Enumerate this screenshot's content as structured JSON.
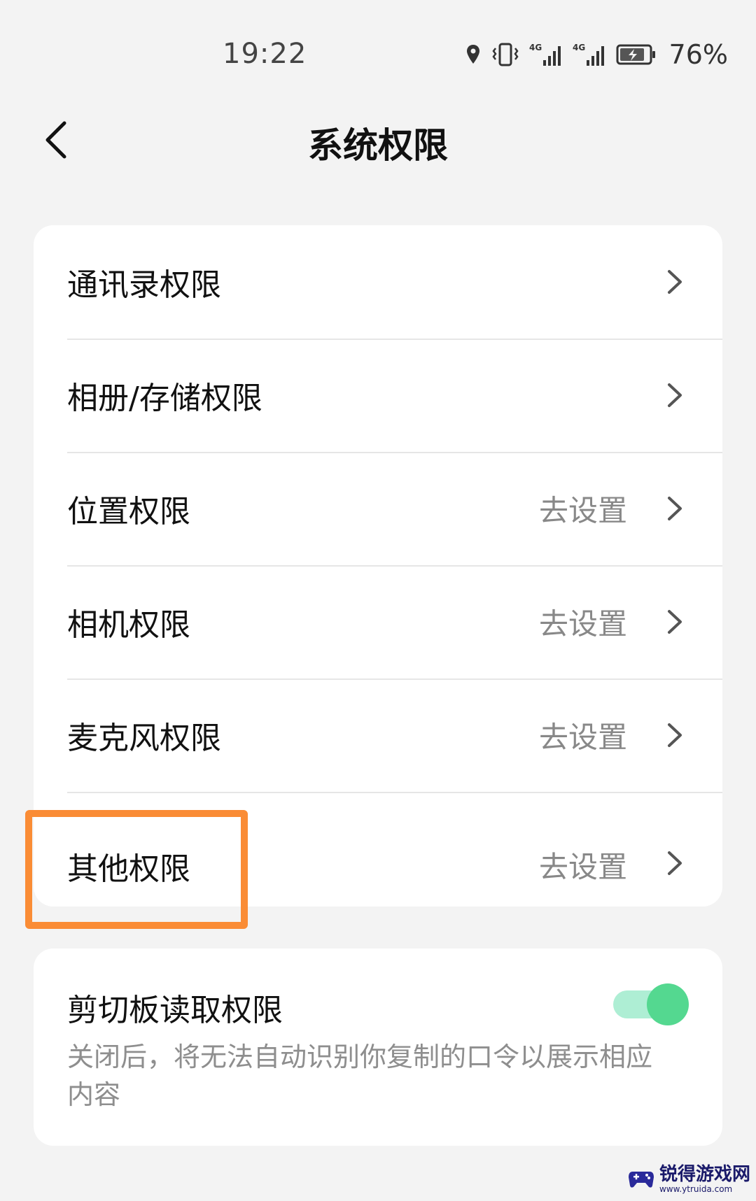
{
  "status_bar": {
    "time": "19:22",
    "battery_percent": "76%",
    "icons": [
      "location-icon",
      "vibrate-icon",
      "signal-4g-icon",
      "signal-4g-icon",
      "battery-charging-icon"
    ]
  },
  "header": {
    "title": "系统权限",
    "back_icon": "chevron-left-icon"
  },
  "permissions": [
    {
      "label": "通讯录权限",
      "action": ""
    },
    {
      "label": "相册/存储权限",
      "action": ""
    },
    {
      "label": "位置权限",
      "action": "去设置"
    },
    {
      "label": "相机权限",
      "action": "去设置"
    },
    {
      "label": "麦克风权限",
      "action": "去设置"
    },
    {
      "label": "其他权限",
      "action": "去设置"
    }
  ],
  "clipboard": {
    "title": "剪切板读取权限",
    "description": "关闭后，将无法自动识别你复制的口令以展示相应内容",
    "enabled": true
  },
  "watermark": {
    "name": "锐得游戏网",
    "url": "www.ytruida.com"
  },
  "colors": {
    "highlight": "#fa8c35",
    "toggle_on": "#54d890",
    "toggle_track": "#aeeed4",
    "background": "#f3f3f3"
  }
}
